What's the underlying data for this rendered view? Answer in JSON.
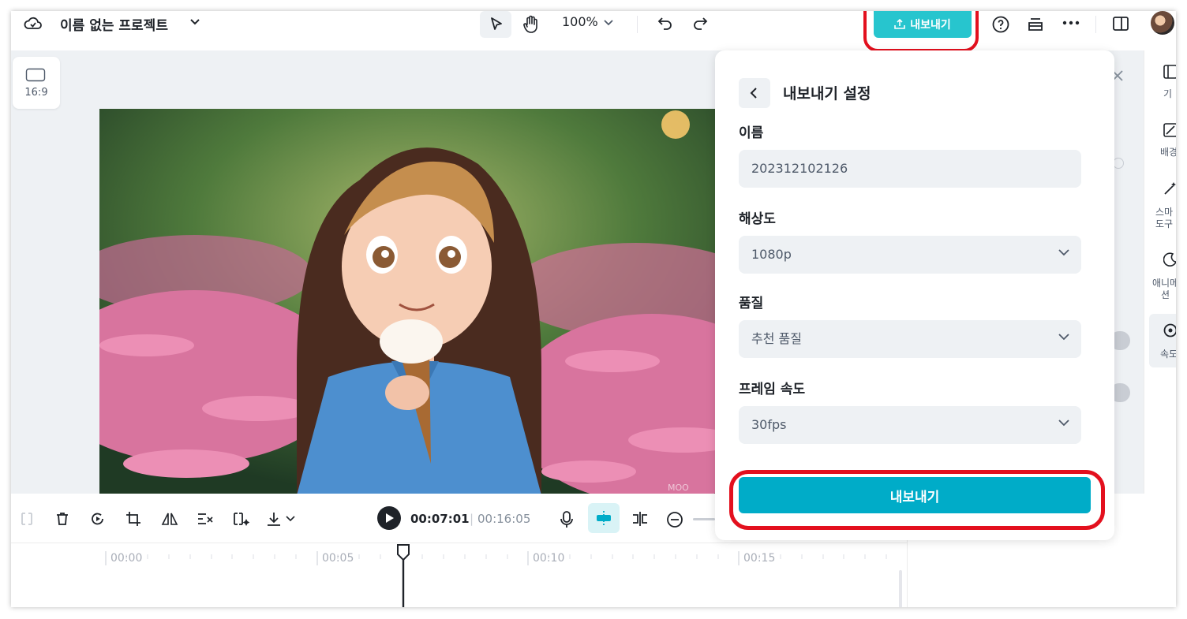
{
  "header": {
    "project_title": "이름 없는 프로젝트",
    "zoom": "100%",
    "export_button_label": "내보내기"
  },
  "canvas": {
    "aspect_ratio_label": "16:9",
    "watermark_text": "MOO"
  },
  "right_sidebar": {
    "items": [
      {
        "label": "기",
        "icon": "layout-icon"
      },
      {
        "label": "배경",
        "icon": "background-icon"
      },
      {
        "label": "스마\n도구",
        "icon": "magic-wand-icon"
      },
      {
        "label": "애니메\n션",
        "icon": "animation-icon"
      },
      {
        "label": "속도",
        "icon": "speed-icon"
      }
    ]
  },
  "export_panel": {
    "title": "내보내기 설정",
    "name_label": "이름",
    "name_value": "202312102126",
    "resolution_label": "해상도",
    "resolution_value": "1080p",
    "quality_label": "품질",
    "quality_value": "추천 품질",
    "framerate_label": "프레임 속도",
    "framerate_value": "30fps",
    "export_button_label": "내보내기"
  },
  "player": {
    "current_time": "00:07:01",
    "separator": "|",
    "total_time": "00:16:05"
  },
  "timeline": {
    "ticks": [
      "00:00",
      "00:05",
      "00:10",
      "00:15"
    ]
  },
  "colors": {
    "accent": "#00acc8",
    "top_export": "#27c5ce",
    "highlight_ring": "#e3101e",
    "active_tool_bg": "#d9f3f6"
  }
}
